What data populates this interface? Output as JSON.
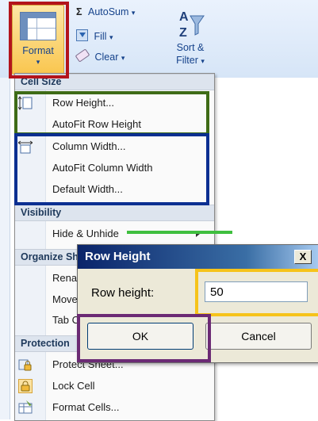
{
  "ribbon": {
    "format_label": "Format",
    "format_arrow": "▾",
    "autosum_label": "AutoSum",
    "fill_label": "Fill",
    "clear_label": "Clear",
    "sort_label_1": "Sort &",
    "sort_label_2": "Filter",
    "dropdown_glyph": "▾",
    "sigma_glyph": "Σ"
  },
  "menu": {
    "cell_size": {
      "header": "Cell Size",
      "items": [
        {
          "label": "Row Height...",
          "icon": "row-height-icon"
        },
        {
          "label": "AutoFit Row Height",
          "icon": ""
        },
        {
          "label": "Column Width...",
          "icon": "column-width-icon"
        },
        {
          "label": "AutoFit Column Width",
          "icon": ""
        },
        {
          "label": "Default Width...",
          "icon": ""
        }
      ]
    },
    "visibility": {
      "header": "Visibility",
      "items": [
        {
          "label": "Hide & Unhide",
          "has_submenu": true
        }
      ]
    },
    "organize": {
      "header": "Organize Sheets",
      "items": [
        {
          "label": "Rename Sheet"
        },
        {
          "label": "Move or Copy Sheet..."
        },
        {
          "label": "Tab Color"
        }
      ]
    },
    "protection": {
      "header": "Protection",
      "items": [
        {
          "label": "Protect Sheet...",
          "icon": "protect-sheet-icon"
        },
        {
          "label": "Lock Cell",
          "icon": "lock-icon"
        },
        {
          "label": "Format Cells...",
          "icon": "format-cells-icon"
        }
      ]
    }
  },
  "dialog": {
    "title": "Row Height",
    "close_glyph": "X",
    "field_label": "Row height:",
    "field_value": "50",
    "ok_label": "OK",
    "cancel_label": "Cancel"
  },
  "colors": {
    "highlight_red": "#b3141b",
    "highlight_green": "#3e6b16",
    "highlight_blue": "#0b2f91",
    "highlight_yellow": "#f6c31a",
    "highlight_purple": "#6b2a74"
  }
}
